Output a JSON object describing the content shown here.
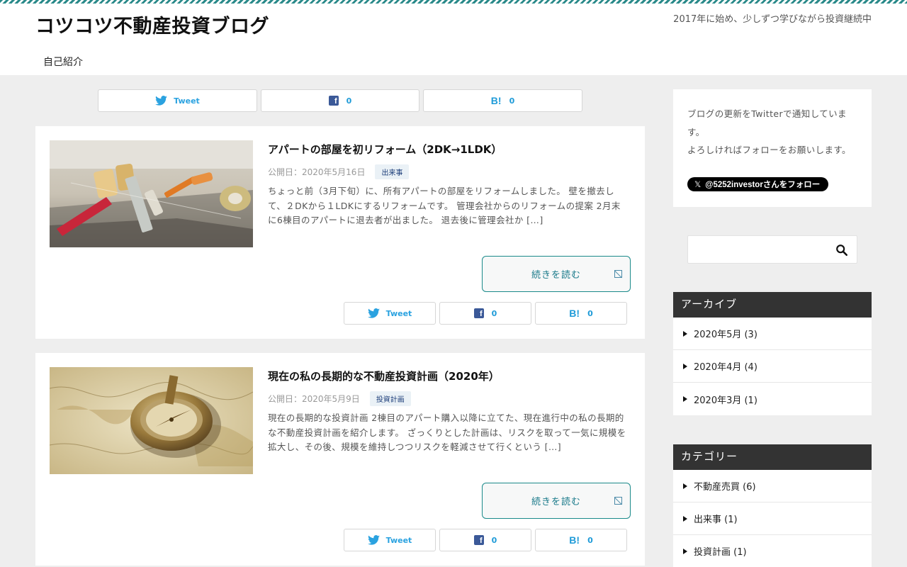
{
  "site": {
    "title": "コツコツ不動産投資ブログ",
    "tagline": "2017年に始め、少しずつ学びながら投資継続中",
    "nav": [
      "自己紹介"
    ]
  },
  "share": {
    "tweet_label": "Tweet",
    "facebook_icon": "f",
    "facebook_count": "0",
    "hatena_icon": "B!",
    "hatena_count": "0"
  },
  "posts": [
    {
      "title": "アパートの部屋を初リフォーム（2DK→1LDK）",
      "date": "公開日：2020年5月16日",
      "category": "出来事",
      "excerpt": "ちょっと前（3月下旬）に、所有アパートの部屋をリフォームしました。 壁を撤去して、２DKから１LDKにするリフォームです。 管理会社からのリフォームの提案 2月末に6棟目のアパートに退去者が出ました。 退去後に管理会社か […]",
      "readmore": "続きを読む",
      "thumb_icon": "renovation-tools-photo"
    },
    {
      "title": "現在の私の長期的な不動産投資計画（2020年）",
      "date": "公開日：2020年5月9日",
      "category": "投資計画",
      "excerpt": "現在の長期的な投資計画 2棟目のアパート購入以降に立てた、現在進行中の私の長期的な不動産投資計画を紹介します。 ざっくりとした計画は、リスクを取って一気に規模を拡大し、その後、規模を維持しつつリスクを軽減させて行くという […]",
      "readmore": "続きを読む",
      "thumb_icon": "compass-on-map-photo"
    }
  ],
  "sidebar": {
    "twitter_widget": {
      "text": "ブログの更新をTwitterで通知しています。\nよろしければフォローをお願いします。",
      "follow_label": "@5252investorさんをフォロー",
      "x_icon": "𝕏"
    },
    "search": {
      "placeholder": ""
    },
    "archive": {
      "title": "アーカイブ",
      "items": [
        "2020年5月 (3)",
        "2020年4月 (4)",
        "2020年3月 (1)"
      ]
    },
    "categories": {
      "title": "カテゴリー",
      "items": [
        "不動産売買 (6)",
        "出来事 (1)",
        "投資計画 (1)"
      ]
    }
  },
  "colors": {
    "accent_teal": "#1a8a8a",
    "twitter_blue": "#2aa2e0",
    "facebook_blue": "#3b5998",
    "widget_header": "#333333"
  }
}
